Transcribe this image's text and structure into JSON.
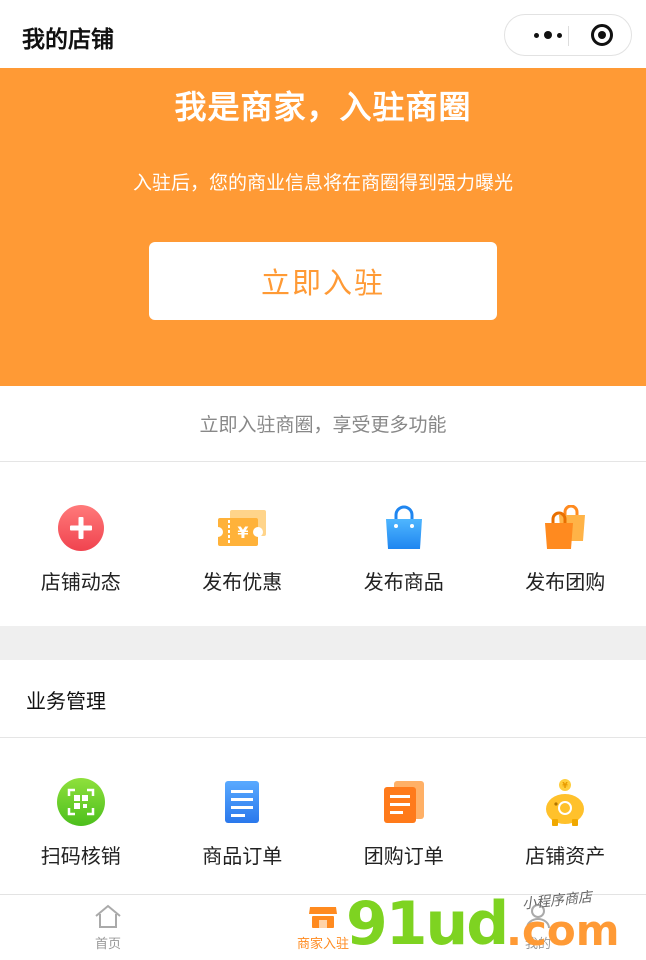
{
  "header": {
    "title": "我的店铺"
  },
  "hero": {
    "title": "我是商家，入驻商圈",
    "subtitle": "入驻后，您的商业信息将在商圈得到强力曝光",
    "button_label": "立即入驻"
  },
  "promo_text": "立即入驻商圈，享受更多功能",
  "quick_actions": [
    {
      "label": "店铺动态",
      "icon": "plus-circle-icon"
    },
    {
      "label": "发布优惠",
      "icon": "coupon-icon"
    },
    {
      "label": "发布商品",
      "icon": "shopping-bag-icon"
    },
    {
      "label": "发布团购",
      "icon": "group-bags-icon"
    }
  ],
  "business": {
    "title": "业务管理",
    "items": [
      {
        "label": "扫码核销",
        "icon": "qr-scan-icon"
      },
      {
        "label": "商品订单",
        "icon": "order-list-icon"
      },
      {
        "label": "团购订单",
        "icon": "group-order-icon"
      },
      {
        "label": "店铺资产",
        "icon": "piggy-bank-icon"
      }
    ]
  },
  "tabbar": {
    "items": [
      {
        "label": "首页",
        "icon": "home-icon",
        "active": false
      },
      {
        "label": "商家入驻",
        "icon": "shop-icon",
        "active": true
      },
      {
        "label": "我的",
        "icon": "user-icon",
        "active": false
      }
    ]
  },
  "watermark": {
    "main": "91ud",
    "suffix": ".com",
    "tagline": "小程序商店"
  },
  "colors": {
    "accent": "#ff9a35",
    "background": "#ffffff",
    "divider": "#efefef"
  }
}
